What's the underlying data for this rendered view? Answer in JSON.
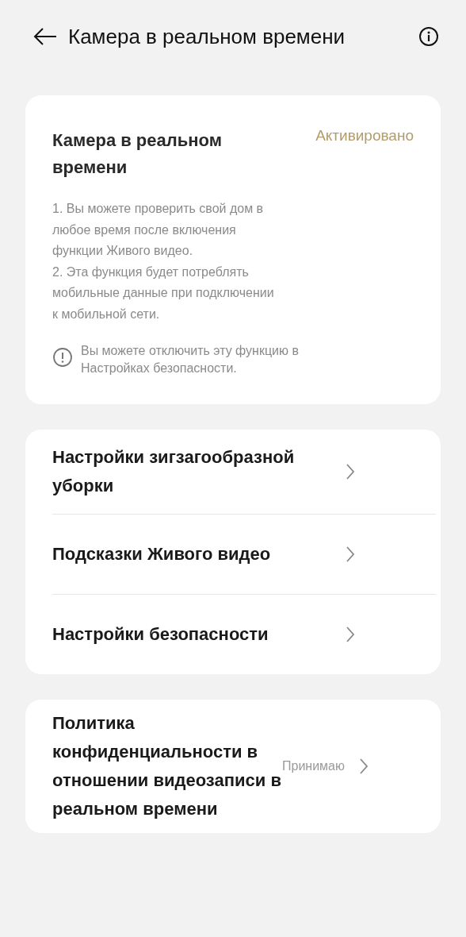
{
  "header": {
    "title": "Камера в реальном времени"
  },
  "feature_card": {
    "title": "Камера в реальном времени",
    "status": "Активировано",
    "description": [
      "1. Вы можете проверить свой дом в любое время после включения функции Живого видео.",
      "2. Эта функция будет потреблять мобильные данные при подключении к мобильной сети."
    ],
    "notice": "Вы можете отключить эту функцию в Настройках безопасности."
  },
  "settings": [
    {
      "label": "Настройки зигзагообразной уборки"
    },
    {
      "label": "Подсказки Живого видео"
    },
    {
      "label": "Настройки безопасности"
    }
  ],
  "policy": {
    "label": "Политика конфиденциальности в отношении видеозаписи в реальном времени",
    "value": "Принимаю"
  }
}
